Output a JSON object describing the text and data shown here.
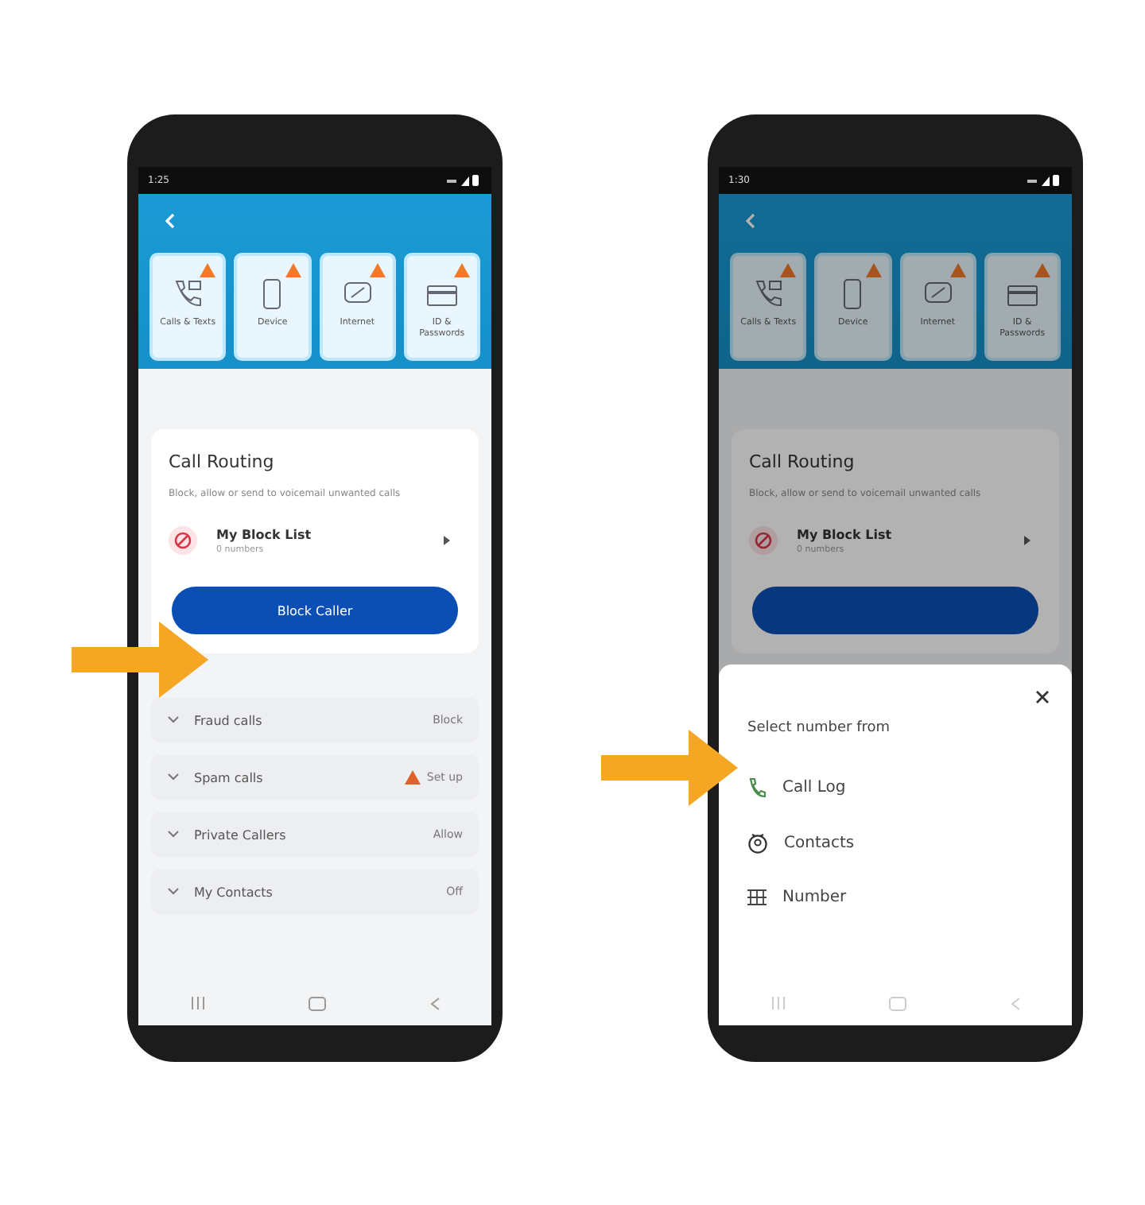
{
  "phones": [
    {
      "status_time": "1:25",
      "dimmed": false,
      "tiles": [
        {
          "label": "Calls & Texts",
          "kind": "calls",
          "warning": true
        },
        {
          "label": "Device",
          "kind": "device",
          "warning": true
        },
        {
          "label": "Internet",
          "kind": "internet",
          "warning": true
        },
        {
          "label": "ID & Passwords",
          "kind": "card",
          "warning": true
        }
      ],
      "card": {
        "title": "Call Routing",
        "description": "Block, allow or send to voicemail unwanted calls",
        "list_item": {
          "title": "My Block List",
          "subtitle": "0 numbers"
        },
        "button": "Block Caller"
      },
      "rows": [
        {
          "label": "Fraud calls",
          "value": "Block",
          "warning": false
        },
        {
          "label": "Spam calls",
          "value": "Set up",
          "warning": true
        },
        {
          "label": "Private Callers",
          "value": "Allow",
          "warning": false
        },
        {
          "label": "My Contacts",
          "value": "Off",
          "warning": false
        }
      ]
    },
    {
      "status_time": "1:30",
      "dimmed": true,
      "tiles": [
        {
          "label": "Calls & Texts",
          "kind": "calls",
          "warning": true
        },
        {
          "label": "Device",
          "kind": "device",
          "warning": true
        },
        {
          "label": "Internet",
          "kind": "internet",
          "warning": true
        },
        {
          "label": "ID & Passwords",
          "kind": "card",
          "warning": true
        }
      ],
      "card": {
        "title": "Call Routing",
        "description": "Block, allow or send to voicemail unwanted calls",
        "list_item": {
          "title": "My Block List",
          "subtitle": "0 numbers"
        }
      },
      "sheet": {
        "title": "Select number from",
        "options": [
          {
            "label": "Call Log",
            "kind": "call-log"
          },
          {
            "label": "Contacts",
            "kind": "contacts"
          },
          {
            "label": "Number",
            "kind": "number"
          }
        ]
      }
    }
  ]
}
